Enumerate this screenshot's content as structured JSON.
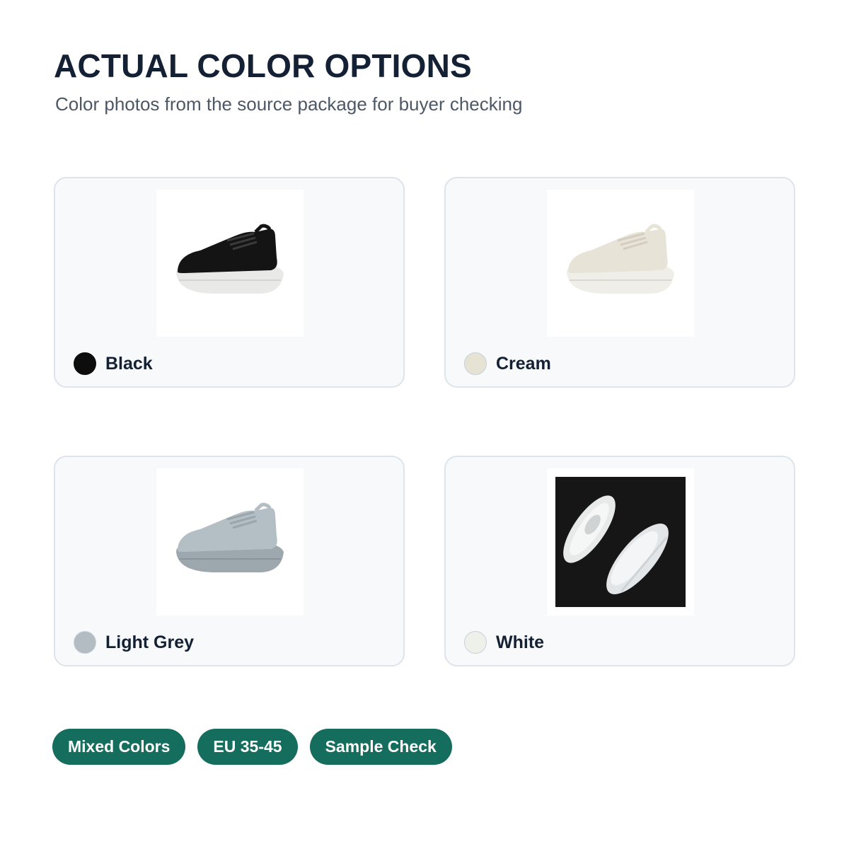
{
  "header": {
    "title": "ACTUAL COLOR OPTIONS",
    "subtitle": "Color photos from the source package for buyer checking"
  },
  "options": [
    {
      "name": "Black",
      "swatch_color": "#0d0d0d",
      "photo_icon": "black-sneaker-photo"
    },
    {
      "name": "Cream",
      "swatch_color": "#e6e2d4",
      "photo_icon": "cream-sneaker-photo"
    },
    {
      "name": "Light Grey",
      "swatch_color": "#b3bcc3",
      "photo_icon": "light-grey-sneaker-photo"
    },
    {
      "name": "White",
      "swatch_color": "#eef0ea",
      "photo_icon": "white-sneaker-pair-photo"
    }
  ],
  "tags": [
    "Mixed Colors",
    "EU 35-45",
    "Sample Check"
  ],
  "colors": {
    "accent": "#156d5d",
    "card_bg": "#f7f9fb",
    "card_border": "#dde4eb"
  }
}
